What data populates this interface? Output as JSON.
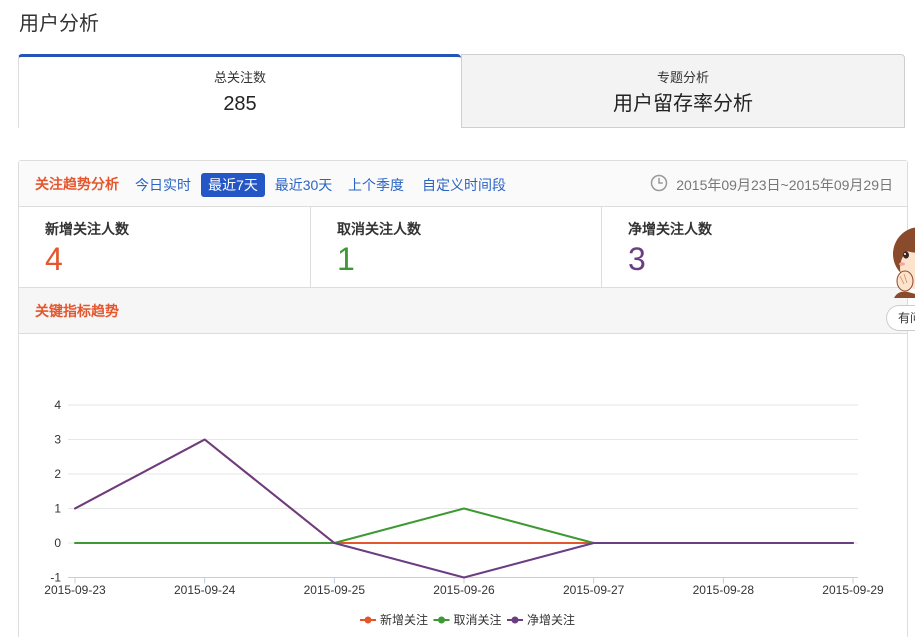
{
  "page_title": "用户分析",
  "theme": {
    "accent": "#e4572e",
    "link": "#2b64c4",
    "selected_bg": "#2457c5",
    "active_tab_border": "#2454b5"
  },
  "summary_tabs": [
    {
      "label": "总关注数",
      "value": "285",
      "active": true
    },
    {
      "label": "专题分析",
      "value": "用户留存率分析",
      "active": false
    }
  ],
  "trend": {
    "title": "关注趋势分析",
    "ranges": [
      "今日实时",
      "最近7天",
      "最近30天",
      "上个季度",
      "自定义时间段"
    ],
    "selected_index": 1,
    "date_icon": "clock-icon",
    "date_range": "2015年09月23日~2015年09月29日"
  },
  "stats": [
    {
      "label": "新增关注人数",
      "value": "4",
      "color": "#e4572e"
    },
    {
      "label": "取消关注人数",
      "value": "1",
      "color": "#3d9a32"
    },
    {
      "label": "净增关注人数",
      "value": "3",
      "color": "#6b3d82"
    }
  ],
  "key_trend": {
    "title": "关键指标趋势"
  },
  "chart_data": {
    "type": "line",
    "categories": [
      "2015-09-23",
      "2015-09-24",
      "2015-09-25",
      "2015-09-26",
      "2015-09-27",
      "2015-09-28",
      "2015-09-29"
    ],
    "series": [
      {
        "name": "新增关注",
        "color": "#e4572e",
        "values": [
          1,
          3,
          0,
          0,
          0,
          0,
          0
        ]
      },
      {
        "name": "取消关注",
        "color": "#3d9a32",
        "values": [
          0,
          0,
          0,
          1,
          0,
          0,
          0
        ]
      },
      {
        "name": "净增关注",
        "color": "#6b3d82",
        "values": [
          1,
          3,
          0,
          -1,
          0,
          0,
          0
        ]
      }
    ],
    "yticks": [
      -1,
      0,
      1,
      2,
      3,
      4
    ],
    "ylim": [
      -1,
      4
    ],
    "grid": true,
    "legend": "bottom-center"
  },
  "helper": {
    "avatar_icon": "helper-avatar-icon",
    "button_label": "有问"
  }
}
